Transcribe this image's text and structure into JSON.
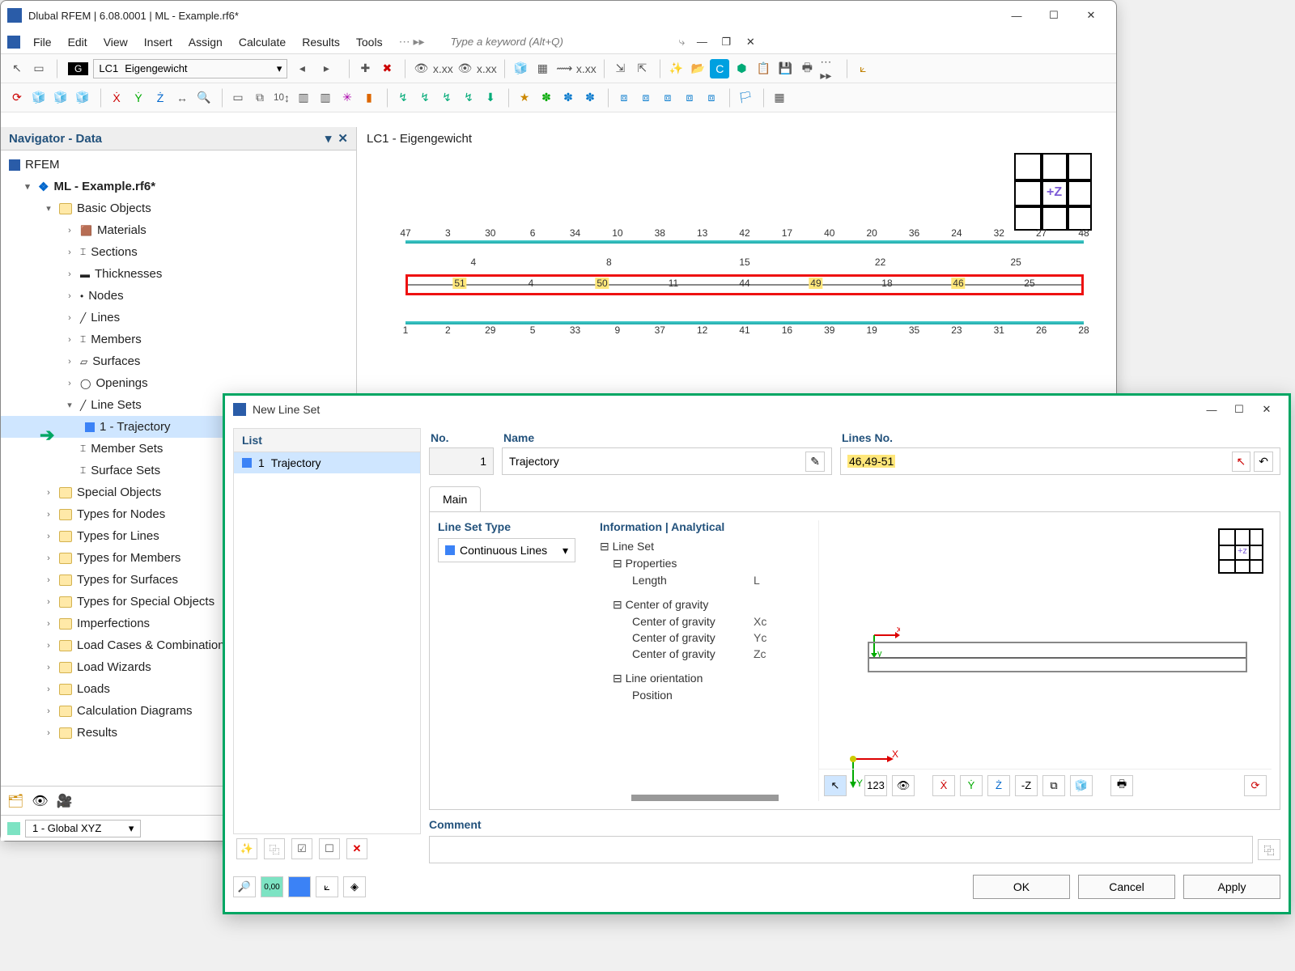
{
  "app": {
    "title": "Dlubal RFEM | 6.08.0001 | ML - Example.rf6*"
  },
  "menu": {
    "items": [
      "File",
      "Edit",
      "View",
      "Insert",
      "Assign",
      "Calculate",
      "Results",
      "Tools"
    ],
    "search_placeholder": "Type a keyword (Alt+Q)"
  },
  "loadcase": {
    "tag": "G",
    "id": "LC1",
    "name": "Eigengewicht"
  },
  "nav": {
    "title": "Navigator - Data",
    "root": "RFEM",
    "model": "ML - Example.rf6*",
    "basic": "Basic Objects",
    "items": [
      "Materials",
      "Sections",
      "Thicknesses",
      "Nodes",
      "Lines",
      "Members",
      "Surfaces",
      "Openings",
      "Line Sets"
    ],
    "lineset_child": "1 - Trajectory",
    "after": [
      "Member Sets",
      "Surface Sets"
    ],
    "groups": [
      "Special Objects",
      "Types for Nodes",
      "Types for Lines",
      "Types for Members",
      "Types for Surfaces",
      "Types for Special Objects",
      "Imperfections",
      "Load Cases & Combinations",
      "Load Wizards",
      "Loads",
      "Calculation Diagrams",
      "Results"
    ],
    "coord": "1 - Global XYZ"
  },
  "canvas": {
    "title": "LC1 - Eigengewicht",
    "axis_label": "+Z",
    "top_nums": [
      "47",
      "3",
      "30",
      "6",
      "34",
      "10",
      "38",
      "13",
      "42",
      "17",
      "40",
      "20",
      "36",
      "24",
      "32",
      "27",
      "48"
    ],
    "top_extra": [
      "4",
      "8",
      "15",
      "22",
      "25"
    ],
    "mid_hl": [
      "51",
      "50",
      "49",
      "46"
    ],
    "mid_plain": [
      "11",
      "44",
      "18"
    ],
    "bot_nums": [
      "1",
      "2",
      "29",
      "5",
      "33",
      "9",
      "37",
      "12",
      "41",
      "16",
      "39",
      "19",
      "35",
      "23",
      "31",
      "26",
      "28"
    ]
  },
  "dialog": {
    "title": "New Line Set",
    "list_header": "List",
    "list_item_no": "1",
    "list_item_name": "Trajectory",
    "no_label": "No.",
    "no_value": "1",
    "name_label": "Name",
    "name_value": "Trajectory",
    "lines_label": "Lines No.",
    "lines_value": "46,49-51",
    "tab": "Main",
    "type_label": "Line Set Type",
    "type_value": "Continuous Lines",
    "info_label": "Information | Analytical",
    "info": {
      "root": "Line Set",
      "props": "Properties",
      "length": "Length",
      "length_sym": "L",
      "cog": "Center of gravity",
      "cog_rows": [
        [
          "Center of gravity",
          "Xc"
        ],
        [
          "Center of gravity",
          "Yc"
        ],
        [
          "Center of gravity",
          "Zc"
        ]
      ],
      "orient": "Line orientation",
      "pos": "Position"
    },
    "preview_axis": "+z",
    "comment_label": "Comment",
    "buttons": {
      "ok": "OK",
      "cancel": "Cancel",
      "apply": "Apply"
    }
  }
}
